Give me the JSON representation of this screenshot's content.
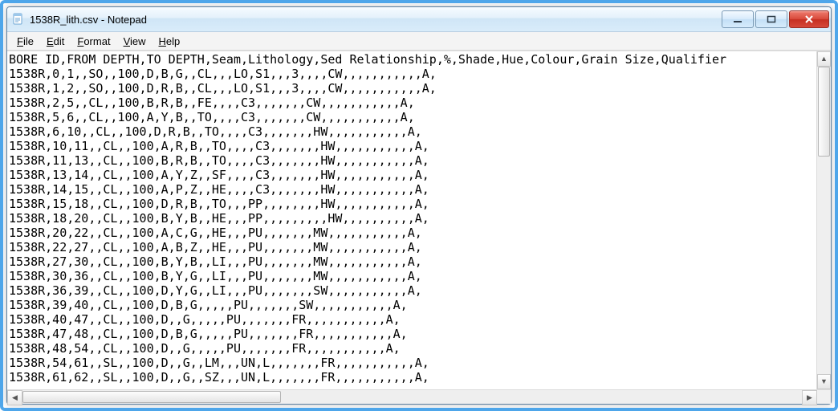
{
  "title": "1538R_lith.csv - Notepad",
  "menu": {
    "file": "File",
    "edit": "Edit",
    "format": "Format",
    "view": "View",
    "help": "Help"
  },
  "lines": [
    "BORE ID,FROM DEPTH,TO DEPTH,Seam,Lithology,Sed Relationship,%,Shade,Hue,Colour,Grain Size,Qualifier",
    "1538R,0,1,,SO,,100,D,B,G,,CL,,,LO,S1,,,3,,,,CW,,,,,,,,,,,A,",
    "1538R,1,2,,SO,,100,D,R,B,,CL,,,LO,S1,,,3,,,,CW,,,,,,,,,,,A,",
    "1538R,2,5,,CL,,100,B,R,B,,FE,,,,C3,,,,,,,CW,,,,,,,,,,,A,",
    "1538R,5,6,,CL,,100,A,Y,B,,TO,,,,C3,,,,,,,CW,,,,,,,,,,,A,",
    "1538R,6,10,,CL,,100,D,R,B,,TO,,,,C3,,,,,,,HW,,,,,,,,,,,A,",
    "1538R,10,11,,CL,,100,A,R,B,,TO,,,,C3,,,,,,,HW,,,,,,,,,,,A,",
    "1538R,11,13,,CL,,100,B,R,B,,TO,,,,C3,,,,,,,HW,,,,,,,,,,,A,",
    "1538R,13,14,,CL,,100,A,Y,Z,,SF,,,,C3,,,,,,,HW,,,,,,,,,,,A,",
    "1538R,14,15,,CL,,100,A,P,Z,,HE,,,,C3,,,,,,,HW,,,,,,,,,,,A,",
    "1538R,15,18,,CL,,100,D,R,B,,TO,,,PP,,,,,,,,HW,,,,,,,,,,,A,",
    "1538R,18,20,,CL,,100,B,Y,B,,HE,,,PP,,,,,,,,,HW,,,,,,,,,,A,",
    "1538R,20,22,,CL,,100,A,C,G,,HE,,,PU,,,,,,,MW,,,,,,,,,,,A,",
    "1538R,22,27,,CL,,100,A,B,Z,,HE,,,PU,,,,,,,MW,,,,,,,,,,,A,",
    "1538R,27,30,,CL,,100,B,Y,B,,LI,,,PU,,,,,,,MW,,,,,,,,,,,A,",
    "1538R,30,36,,CL,,100,B,Y,G,,LI,,,PU,,,,,,,MW,,,,,,,,,,,A,",
    "1538R,36,39,,CL,,100,D,Y,G,,LI,,,PU,,,,,,,SW,,,,,,,,,,,A,",
    "1538R,39,40,,CL,,100,D,B,G,,,,,PU,,,,,,,SW,,,,,,,,,,,A,",
    "1538R,40,47,,CL,,100,D,,G,,,,,PU,,,,,,,FR,,,,,,,,,,,A,",
    "1538R,47,48,,CL,,100,D,B,G,,,,,PU,,,,,,,FR,,,,,,,,,,,A,",
    "1538R,48,54,,CL,,100,D,,G,,,,,PU,,,,,,,FR,,,,,,,,,,,A,",
    "1538R,54,61,,SL,,100,D,,G,,LM,,,UN,L,,,,,,,FR,,,,,,,,,,,A,",
    "1538R,61,62,,SL,,100,D,,G,,SZ,,,UN,L,,,,,,,FR,,,,,,,,,,,A,"
  ]
}
